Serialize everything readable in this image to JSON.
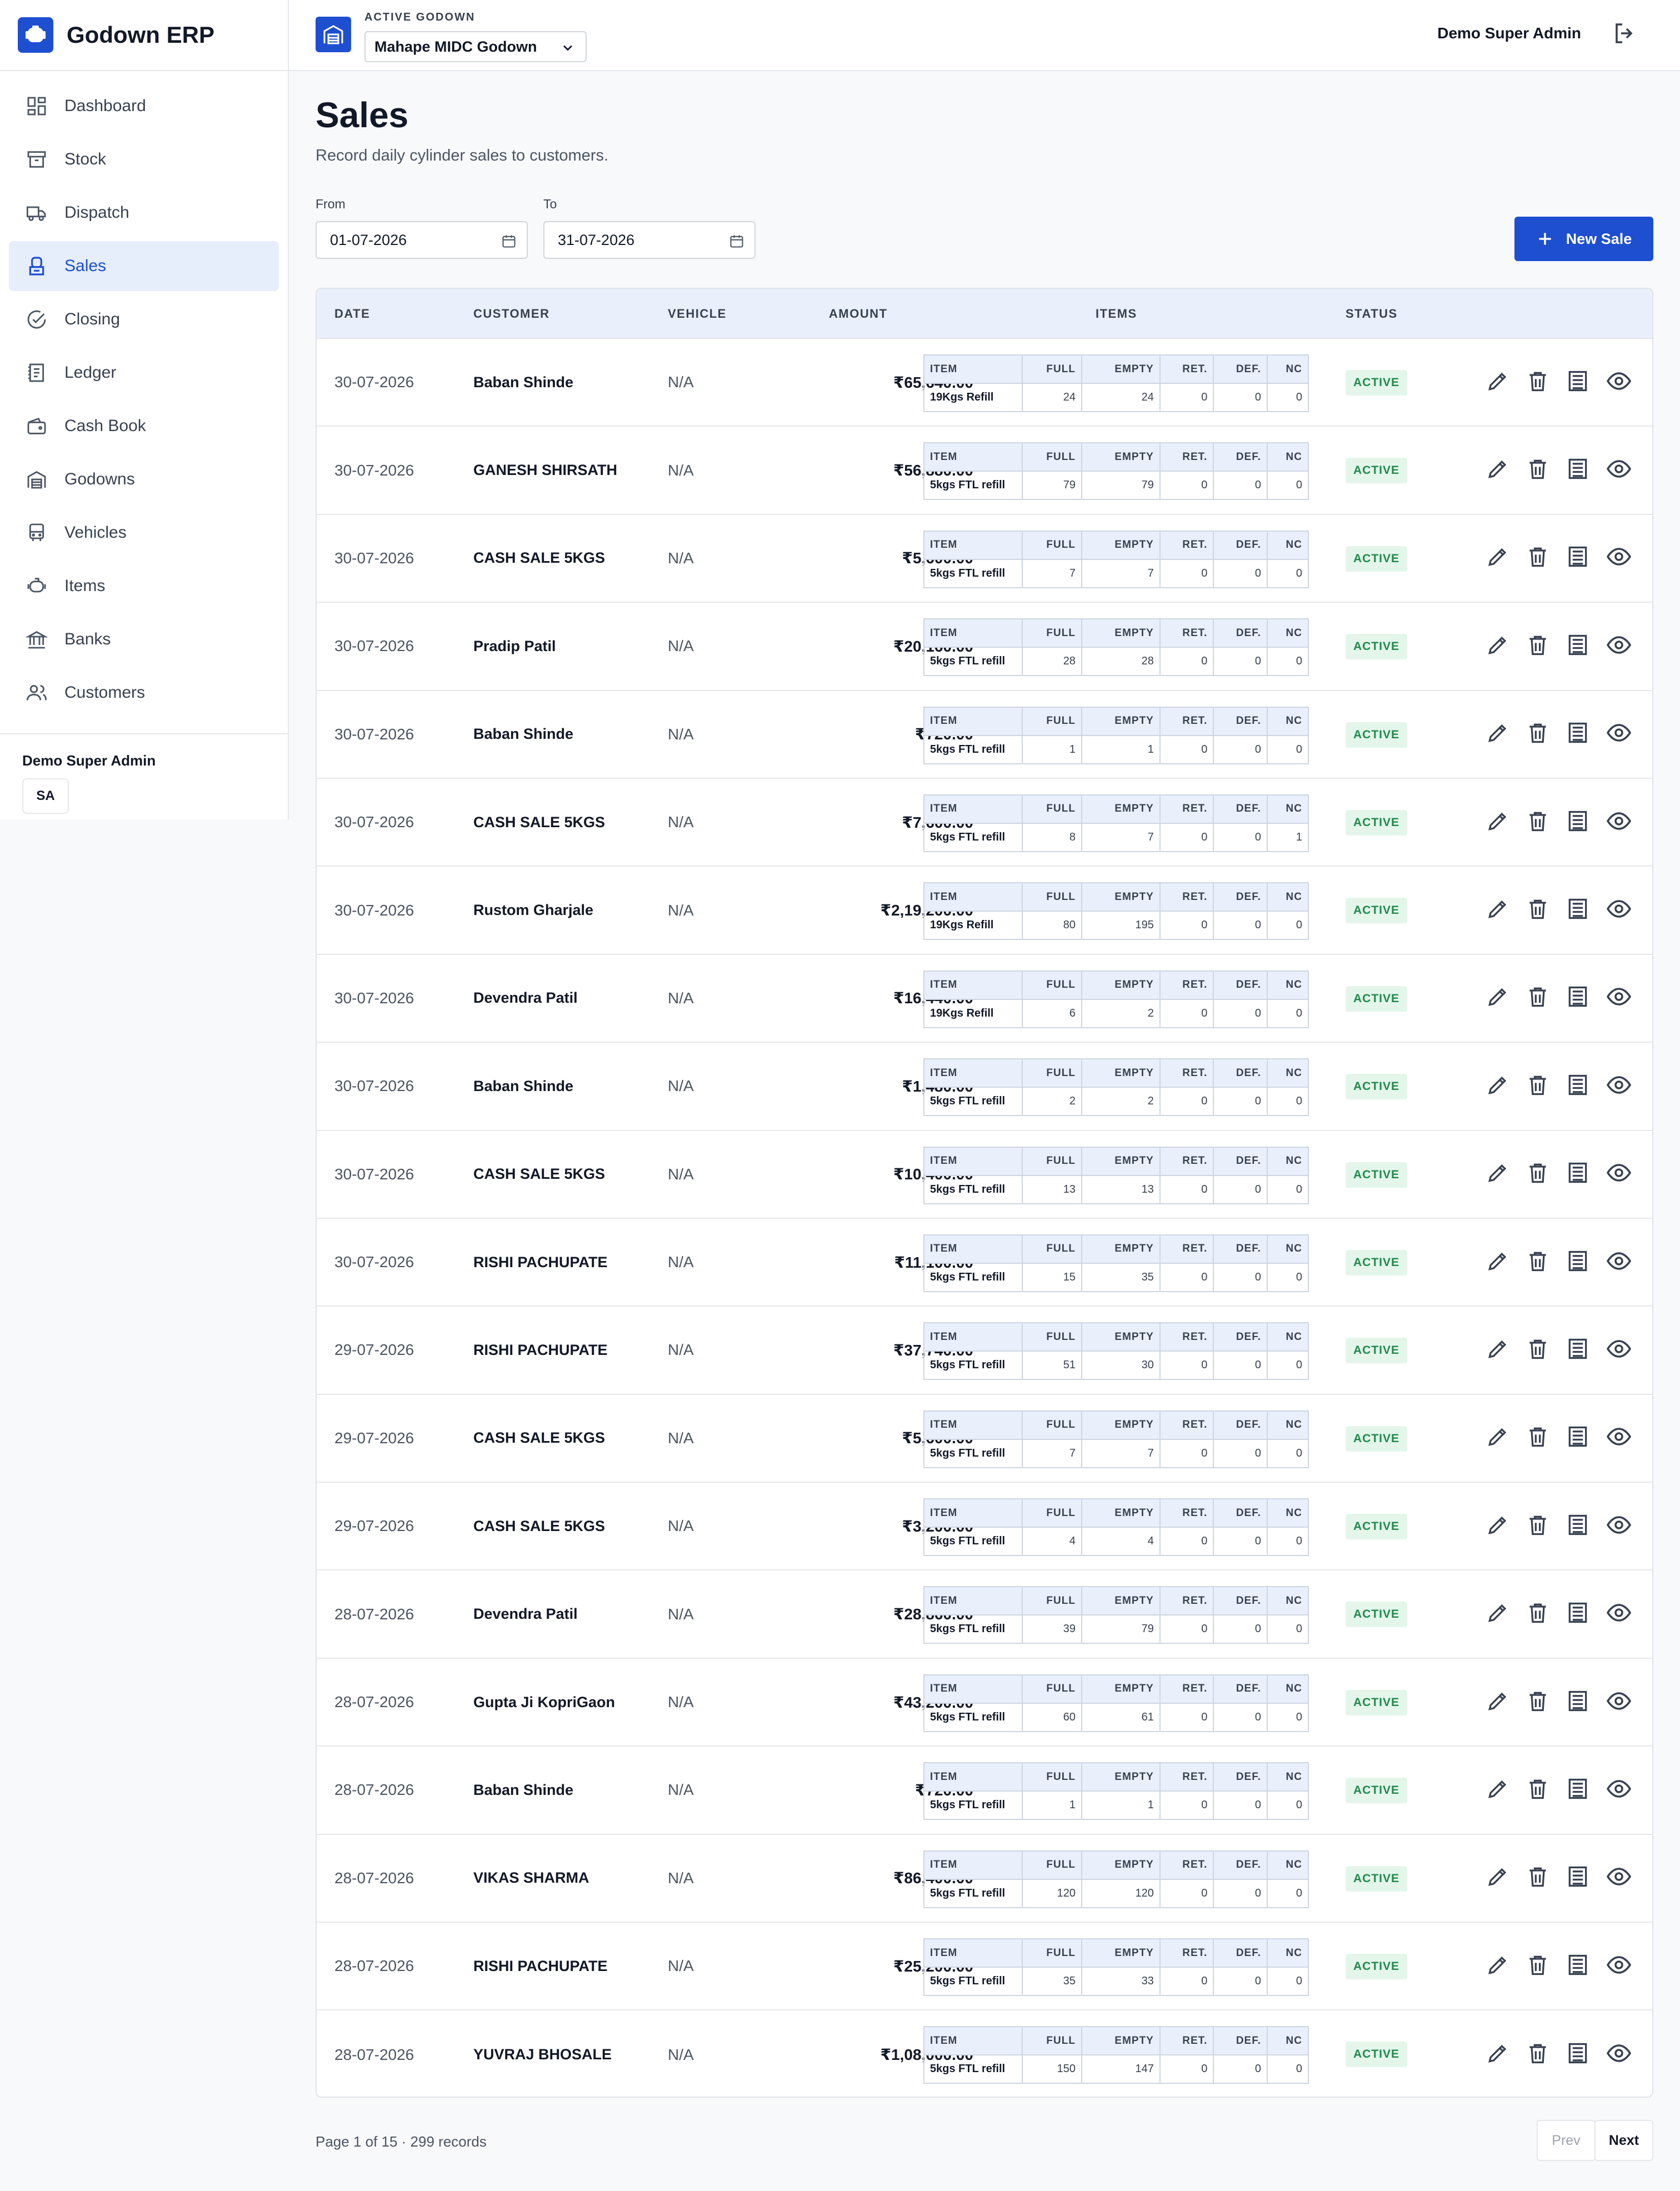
{
  "app": {
    "name": "Godown ERP"
  },
  "nav": [
    {
      "label": "Dashboard",
      "icon": "dashboard-icon",
      "active": false
    },
    {
      "label": "Stock",
      "icon": "box-icon",
      "active": false
    },
    {
      "label": "Dispatch",
      "icon": "truck-icon",
      "active": false
    },
    {
      "label": "Sales",
      "icon": "sales-icon",
      "active": true
    },
    {
      "label": "Closing",
      "icon": "check-circle-icon",
      "active": false
    },
    {
      "label": "Ledger",
      "icon": "ledger-icon",
      "active": false
    },
    {
      "label": "Cash Book",
      "icon": "wallet-icon",
      "active": false
    },
    {
      "label": "Godowns",
      "icon": "warehouse-icon",
      "active": false
    },
    {
      "label": "Vehicles",
      "icon": "bus-icon",
      "active": false
    },
    {
      "label": "Items",
      "icon": "cylinder-icon",
      "active": false
    },
    {
      "label": "Banks",
      "icon": "bank-icon",
      "active": false
    },
    {
      "label": "Customers",
      "icon": "users-icon",
      "active": false
    }
  ],
  "sidebar_user": {
    "name": "Demo Super Admin",
    "initials": "SA"
  },
  "topbar": {
    "godown_label": "ACTIVE GODOWN",
    "godown_value": "Mahape MIDC Godown",
    "user_name": "Demo Super Admin"
  },
  "page": {
    "title": "Sales",
    "subtitle": "Record daily cylinder sales to customers.",
    "from_label": "From",
    "from_value": "01-07-2026",
    "to_label": "To",
    "to_value": "31-07-2026",
    "new_button": "New Sale"
  },
  "table": {
    "headers": {
      "date": "DATE",
      "customer": "CUSTOMER",
      "vehicle": "VEHICLE",
      "amount": "AMOUNT",
      "items": "ITEMS",
      "status": "STATUS"
    },
    "item_headers": {
      "item": "ITEM",
      "full": "FULL",
      "empty": "EMPTY",
      "ret": "RET.",
      "def": "DEF.",
      "nc": "NC"
    },
    "rows": [
      {
        "date": "30-07-2026",
        "customer": "Baban Shinde",
        "vehicle": "N/A",
        "amount": "₹65,640.00",
        "item": "19Kgs Refill",
        "full": "24",
        "empty": "24",
        "ret": "0",
        "def": "0",
        "nc": "0",
        "status": "ACTIVE"
      },
      {
        "date": "30-07-2026",
        "customer": "GANESH SHIRSATH",
        "vehicle": "N/A",
        "amount": "₹56,880.00",
        "item": "5kgs FTL refill",
        "full": "79",
        "empty": "79",
        "ret": "0",
        "def": "0",
        "nc": "0",
        "status": "ACTIVE"
      },
      {
        "date": "30-07-2026",
        "customer": "CASH SALE 5KGS",
        "vehicle": "N/A",
        "amount": "₹5,600.00",
        "item": "5kgs FTL refill",
        "full": "7",
        "empty": "7",
        "ret": "0",
        "def": "0",
        "nc": "0",
        "status": "ACTIVE"
      },
      {
        "date": "30-07-2026",
        "customer": "Pradip Patil",
        "vehicle": "N/A",
        "amount": "₹20,160.00",
        "item": "5kgs FTL refill",
        "full": "28",
        "empty": "28",
        "ret": "0",
        "def": "0",
        "nc": "0",
        "status": "ACTIVE"
      },
      {
        "date": "30-07-2026",
        "customer": "Baban Shinde",
        "vehicle": "N/A",
        "amount": "₹720.00",
        "item": "5kgs FTL refill",
        "full": "1",
        "empty": "1",
        "ret": "0",
        "def": "0",
        "nc": "0",
        "status": "ACTIVE"
      },
      {
        "date": "30-07-2026",
        "customer": "CASH SALE 5KGS",
        "vehicle": "N/A",
        "amount": "₹7,600.00",
        "item": "5kgs FTL refill",
        "full": "8",
        "empty": "7",
        "ret": "0",
        "def": "0",
        "nc": "1",
        "status": "ACTIVE"
      },
      {
        "date": "30-07-2026",
        "customer": "Rustom Gharjale",
        "vehicle": "N/A",
        "amount": "₹2,19,200.00",
        "item": "19Kgs Refill",
        "full": "80",
        "empty": "195",
        "ret": "0",
        "def": "0",
        "nc": "0",
        "status": "ACTIVE"
      },
      {
        "date": "30-07-2026",
        "customer": "Devendra Patil",
        "vehicle": "N/A",
        "amount": "₹16,440.00",
        "item": "19Kgs Refill",
        "full": "6",
        "empty": "2",
        "ret": "0",
        "def": "0",
        "nc": "0",
        "status": "ACTIVE"
      },
      {
        "date": "30-07-2026",
        "customer": "Baban Shinde",
        "vehicle": "N/A",
        "amount": "₹1,480.00",
        "item": "5kgs FTL refill",
        "full": "2",
        "empty": "2",
        "ret": "0",
        "def": "0",
        "nc": "0",
        "status": "ACTIVE"
      },
      {
        "date": "30-07-2026",
        "customer": "CASH SALE 5KGS",
        "vehicle": "N/A",
        "amount": "₹10,400.00",
        "item": "5kgs FTL refill",
        "full": "13",
        "empty": "13",
        "ret": "0",
        "def": "0",
        "nc": "0",
        "status": "ACTIVE"
      },
      {
        "date": "30-07-2026",
        "customer": "RISHI PACHUPATE",
        "vehicle": "N/A",
        "amount": "₹11,100.00",
        "item": "5kgs FTL refill",
        "full": "15",
        "empty": "35",
        "ret": "0",
        "def": "0",
        "nc": "0",
        "status": "ACTIVE"
      },
      {
        "date": "29-07-2026",
        "customer": "RISHI PACHUPATE",
        "vehicle": "N/A",
        "amount": "₹37,740.00",
        "item": "5kgs FTL refill",
        "full": "51",
        "empty": "30",
        "ret": "0",
        "def": "0",
        "nc": "0",
        "status": "ACTIVE"
      },
      {
        "date": "29-07-2026",
        "customer": "CASH SALE 5KGS",
        "vehicle": "N/A",
        "amount": "₹5,600.00",
        "item": "5kgs FTL refill",
        "full": "7",
        "empty": "7",
        "ret": "0",
        "def": "0",
        "nc": "0",
        "status": "ACTIVE"
      },
      {
        "date": "29-07-2026",
        "customer": "CASH SALE 5KGS",
        "vehicle": "N/A",
        "amount": "₹3,200.00",
        "item": "5kgs FTL refill",
        "full": "4",
        "empty": "4",
        "ret": "0",
        "def": "0",
        "nc": "0",
        "status": "ACTIVE"
      },
      {
        "date": "28-07-2026",
        "customer": "Devendra Patil",
        "vehicle": "N/A",
        "amount": "₹28,860.00",
        "item": "5kgs FTL refill",
        "full": "39",
        "empty": "79",
        "ret": "0",
        "def": "0",
        "nc": "0",
        "status": "ACTIVE"
      },
      {
        "date": "28-07-2026",
        "customer": "Gupta Ji KopriGaon",
        "vehicle": "N/A",
        "amount": "₹43,200.00",
        "item": "5kgs FTL refill",
        "full": "60",
        "empty": "61",
        "ret": "0",
        "def": "0",
        "nc": "0",
        "status": "ACTIVE"
      },
      {
        "date": "28-07-2026",
        "customer": "Baban Shinde",
        "vehicle": "N/A",
        "amount": "₹720.00",
        "item": "5kgs FTL refill",
        "full": "1",
        "empty": "1",
        "ret": "0",
        "def": "0",
        "nc": "0",
        "status": "ACTIVE"
      },
      {
        "date": "28-07-2026",
        "customer": "VIKAS SHARMA",
        "vehicle": "N/A",
        "amount": "₹86,400.00",
        "item": "5kgs FTL refill",
        "full": "120",
        "empty": "120",
        "ret": "0",
        "def": "0",
        "nc": "0",
        "status": "ACTIVE"
      },
      {
        "date": "28-07-2026",
        "customer": "RISHI PACHUPATE",
        "vehicle": "N/A",
        "amount": "₹25,200.00",
        "item": "5kgs FTL refill",
        "full": "35",
        "empty": "33",
        "ret": "0",
        "def": "0",
        "nc": "0",
        "status": "ACTIVE"
      },
      {
        "date": "28-07-2026",
        "customer": "YUVRAJ BHOSALE",
        "vehicle": "N/A",
        "amount": "₹1,08,000.00",
        "item": "5kgs FTL refill",
        "full": "150",
        "empty": "147",
        "ret": "0",
        "def": "0",
        "nc": "0",
        "status": "ACTIVE"
      }
    ]
  },
  "pagination": {
    "info": "Page 1 of 15 · 299 records",
    "prev": "Prev",
    "next": "Next"
  },
  "colors": {
    "accent": "#1e4fd1",
    "active_bg": "#e6edfb",
    "status_green": "#1f8a4c",
    "status_bg": "#e4f6ea"
  }
}
